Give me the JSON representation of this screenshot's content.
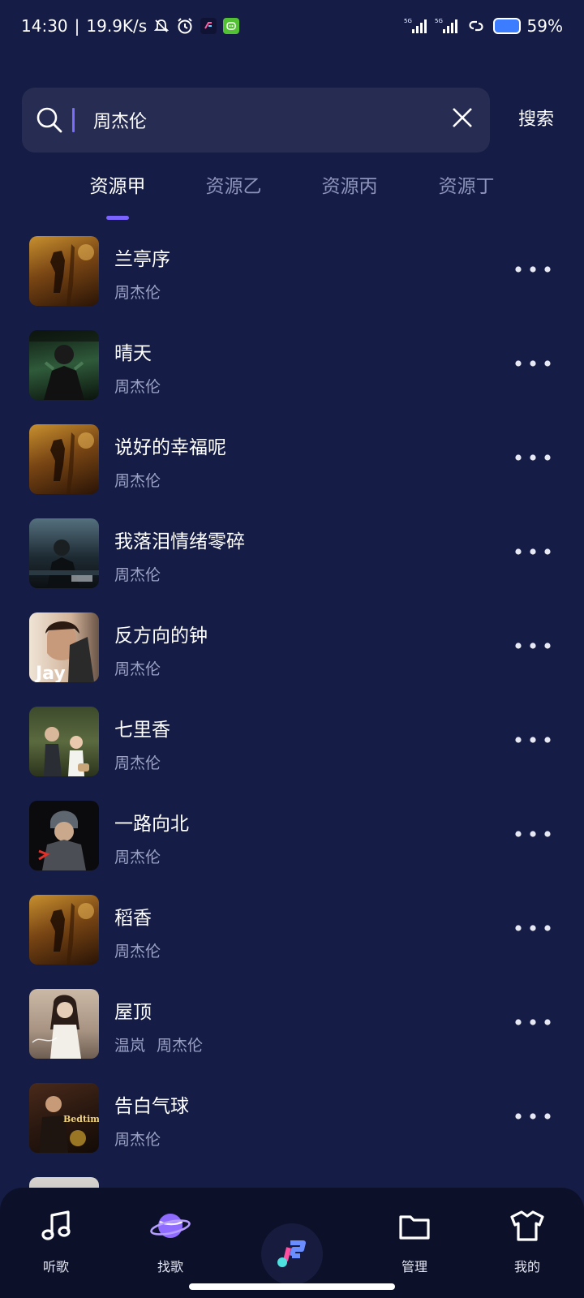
{
  "status_bar": {
    "time": "14:30",
    "speed": "19.9K/s",
    "battery": "59%"
  },
  "search": {
    "query": "周杰伦",
    "button_label": "搜索"
  },
  "tabs": [
    {
      "label": "资源甲",
      "active": true
    },
    {
      "label": "资源乙",
      "active": false
    },
    {
      "label": "资源丙",
      "active": false
    },
    {
      "label": "资源丁",
      "active": false
    }
  ],
  "songs": [
    {
      "title": "兰亭序",
      "artist": "周杰伦"
    },
    {
      "title": "晴天",
      "artist": "周杰伦"
    },
    {
      "title": "说好的幸福呢",
      "artist": "周杰伦"
    },
    {
      "title": "我落泪情绪零碎",
      "artist": "周杰伦"
    },
    {
      "title": "反方向的钟",
      "artist": "周杰伦"
    },
    {
      "title": "七里香",
      "artist": "周杰伦"
    },
    {
      "title": "一路向北",
      "artist": "周杰伦"
    },
    {
      "title": "稻香",
      "artist": "周杰伦"
    },
    {
      "title": "屋顶",
      "artist": "温岚 周杰伦"
    },
    {
      "title": "告白气球",
      "artist": "周杰伦"
    }
  ],
  "cover_texts": {
    "jay": "Jay",
    "bedtime": "Bedtime Stories"
  },
  "bottom_nav": {
    "listen": "听歌",
    "find": "找歌",
    "manage": "管理",
    "mine": "我的"
  },
  "colors": {
    "background": "#151c45",
    "accent": "#7a63ff",
    "search_bg": "#272c52",
    "nav_bg": "#0c1029"
  }
}
